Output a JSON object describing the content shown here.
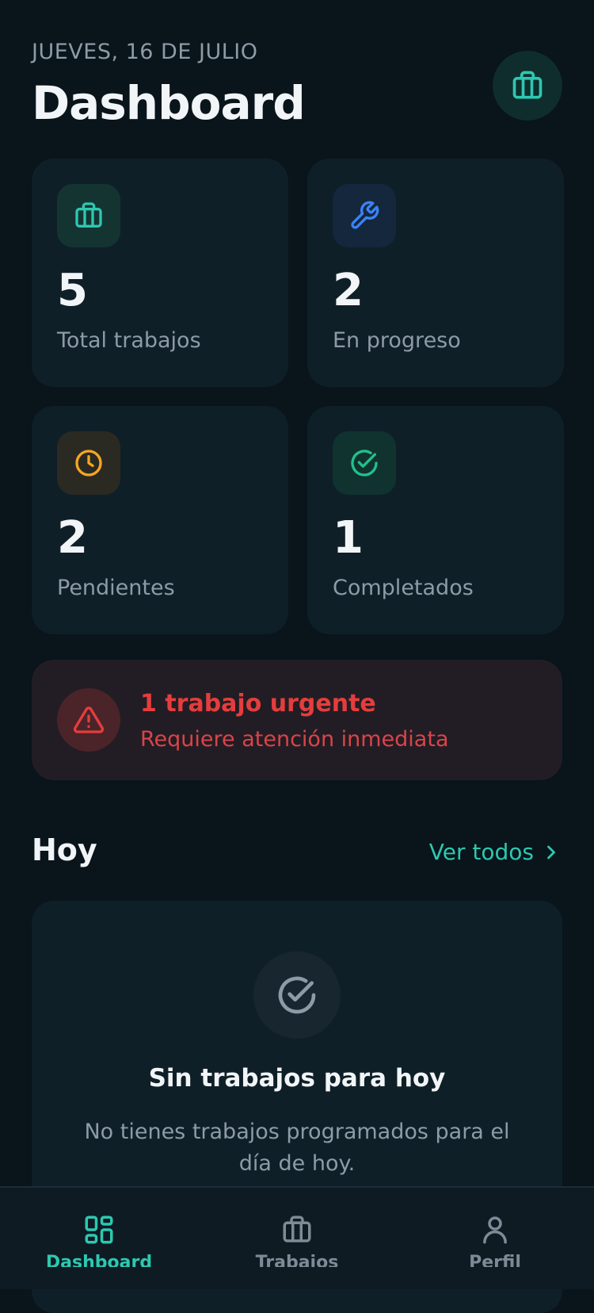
{
  "header": {
    "date": "JUEVES, 16 DE JULIO",
    "title": "Dashboard",
    "action_icon": "briefcase-icon"
  },
  "stats": [
    {
      "value": "5",
      "label": "Total trabajos",
      "icon": "briefcase-icon",
      "color": "#2dc8b0"
    },
    {
      "value": "2",
      "label": "En progreso",
      "icon": "wrench-icon",
      "color": "#3b82f6"
    },
    {
      "value": "2",
      "label": "Pendientes",
      "icon": "clock-icon",
      "color": "#f5a623"
    },
    {
      "value": "1",
      "label": "Completados",
      "icon": "check-circle-icon",
      "color": "#22c08a"
    }
  ],
  "alert": {
    "title": "1 trabajo urgente",
    "subtitle": "Requiere atención inmediata",
    "icon": "warning-icon",
    "color": "#e53d3d"
  },
  "today": {
    "title": "Hoy",
    "see_all": "Ver todos",
    "empty_title": "Sin trabajos para hoy",
    "empty_text": "No tienes trabajos programados para el día de hoy.",
    "empty_icon": "check-circle-icon"
  },
  "tabbar": {
    "active_color": "#2dc8b0",
    "items": [
      {
        "label": "Dashboard",
        "icon": "dashboard-grid-icon",
        "active": true
      },
      {
        "label": "Trabajos",
        "icon": "briefcase-icon",
        "active": false
      },
      {
        "label": "Perfil",
        "icon": "user-icon",
        "active": false
      }
    ]
  }
}
